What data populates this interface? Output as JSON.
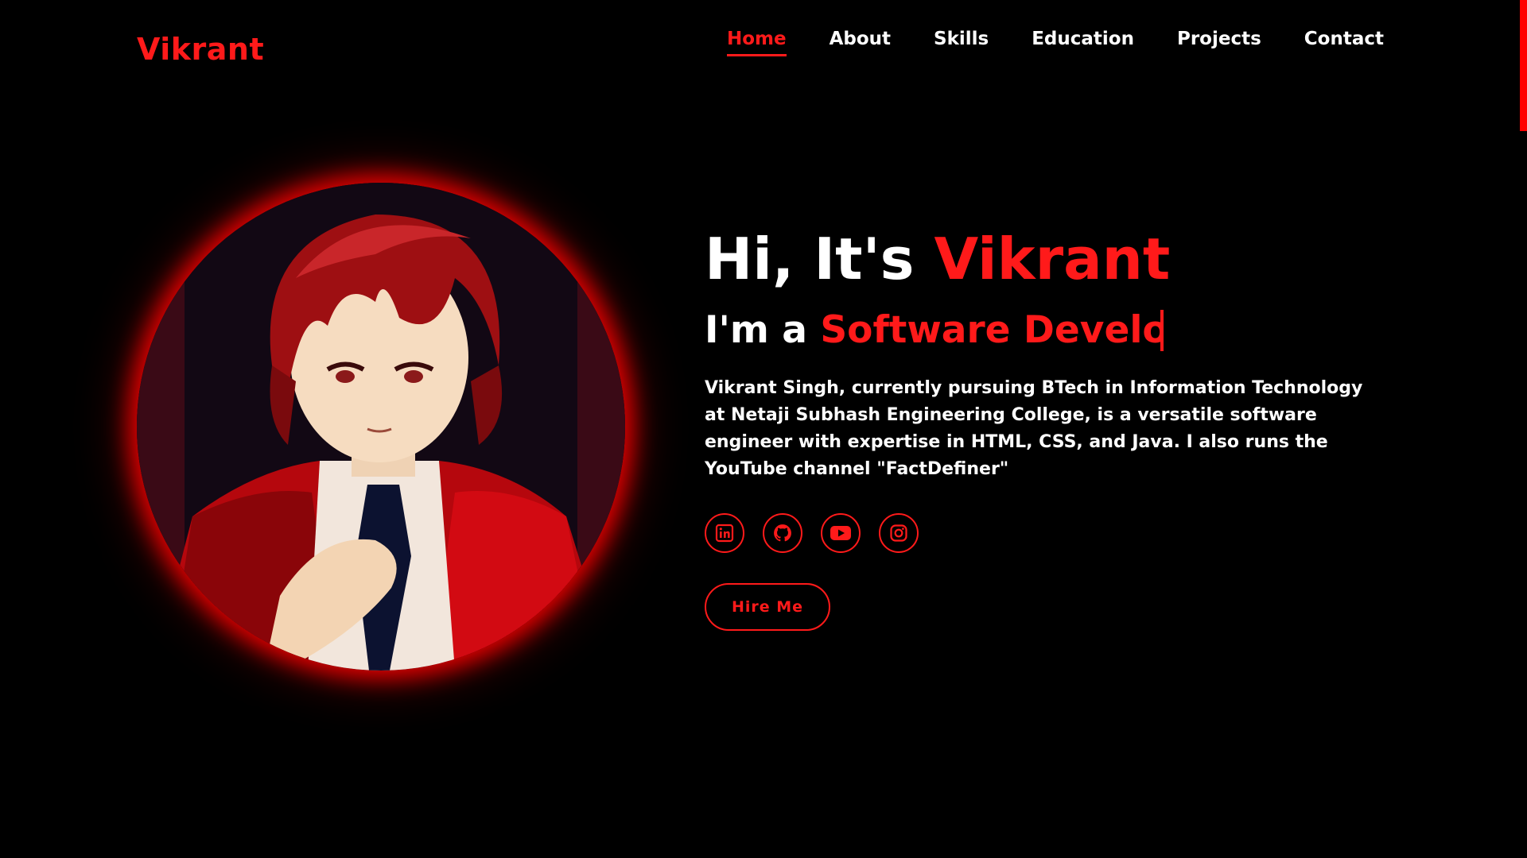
{
  "header": {
    "logo": "Vikrant",
    "nav": [
      {
        "label": "Home",
        "active": true
      },
      {
        "label": "About",
        "active": false
      },
      {
        "label": "Skills",
        "active": false
      },
      {
        "label": "Education",
        "active": false
      },
      {
        "label": "Projects",
        "active": false
      },
      {
        "label": "Contact",
        "active": false
      }
    ]
  },
  "hero": {
    "greeting_prefix": "Hi, It's",
    "greeting_name": "Vikrant",
    "role_prefix": "I'm a",
    "role_typed": "Software Develop",
    "bio": "Vikrant Singh, currently pursuing BTech in Information Technology at Netaji Subhash Engineering College, is a versatile software engineer with expertise in HTML, CSS, and Java. I also runs the YouTube channel \"FactDefiner\"",
    "socials": [
      {
        "icon": "linkedin-icon"
      },
      {
        "icon": "github-icon"
      },
      {
        "icon": "youtube-icon"
      },
      {
        "icon": "instagram-icon"
      }
    ],
    "cta_label": "Hire Me"
  },
  "colors": {
    "accent": "#ff1a1a",
    "background": "#000000",
    "text": "#ffffff"
  }
}
